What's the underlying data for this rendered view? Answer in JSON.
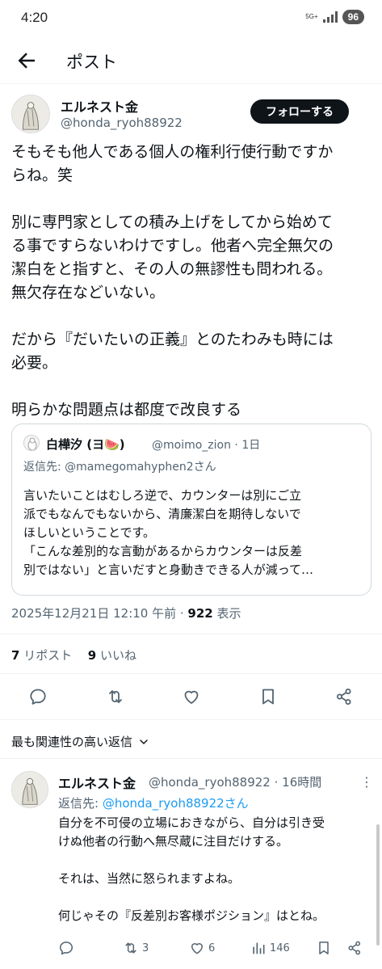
{
  "status": {
    "time": "4:20",
    "network": "5G+",
    "battery": "96"
  },
  "header": {
    "title": "ポスト"
  },
  "post": {
    "author_name": "エルネスト金",
    "author_handle": "@honda_ryoh88922",
    "follow_label": "フォローする",
    "lines": [
      "そもそも他人である個人の権利行使行動ですか",
      "らね。笑",
      "",
      "別に専門家としての積み上げをしてから始めて",
      "る事ですらないわけですし。他者へ完全無欠の",
      "潔白をと指すと、その人の無謬性も問われる。",
      "無欠存在などいない。",
      "",
      "だから『だいたいの正義』とのたわみも時には",
      "必要。",
      "",
      "明らかな問題点は都度で改良する"
    ],
    "timestamp": "2025年12月21日 12:10 午前 · ",
    "views_count": "922",
    "views_label": " 表示",
    "reposts_count": "7",
    "reposts_label": " リポスト",
    "likes_count": "9",
    "likes_label": " いいね"
  },
  "quoted": {
    "name": "白樺汐 (ヨ🍉)",
    "handle_time": "@moimo_zion · 1日",
    "reply_to": "返信先: @mamegomahyphen2さん",
    "lines": [
      "言いたいことはむしろ逆で、カウンターは別にご立",
      "派でもなんでもないから、清廉潔白を期待しないで",
      "ほしいということです。",
      "「こんな差別的な言動があるからカウンターは反差",
      "別ではない」と言いだすと身動きできる人が減って…"
    ]
  },
  "sort": {
    "label": "最も関連性の高い返信"
  },
  "reply": {
    "name": "エルネスト金",
    "handle_time": "@honda_ryoh88922 · 16時間",
    "reply_to_prefix": "返信先: ",
    "reply_to_handle": "@honda_ryoh88922さん",
    "more": "⋮",
    "lines": [
      "自分を不可侵の立場におきながら、自分は引き受",
      "けぬ他者の行動へ無尽蔵に注目だけする。",
      "",
      "それは、当然に怒られますよね。",
      "",
      "何じゃその『反差別お客様ポジション』はとね。"
    ],
    "reposts": "3",
    "likes": "6",
    "views": "146"
  },
  "colors": {
    "text": "#0f1419",
    "secondary": "#536471",
    "link": "#1d9bf0",
    "border": "#cfd9de"
  }
}
